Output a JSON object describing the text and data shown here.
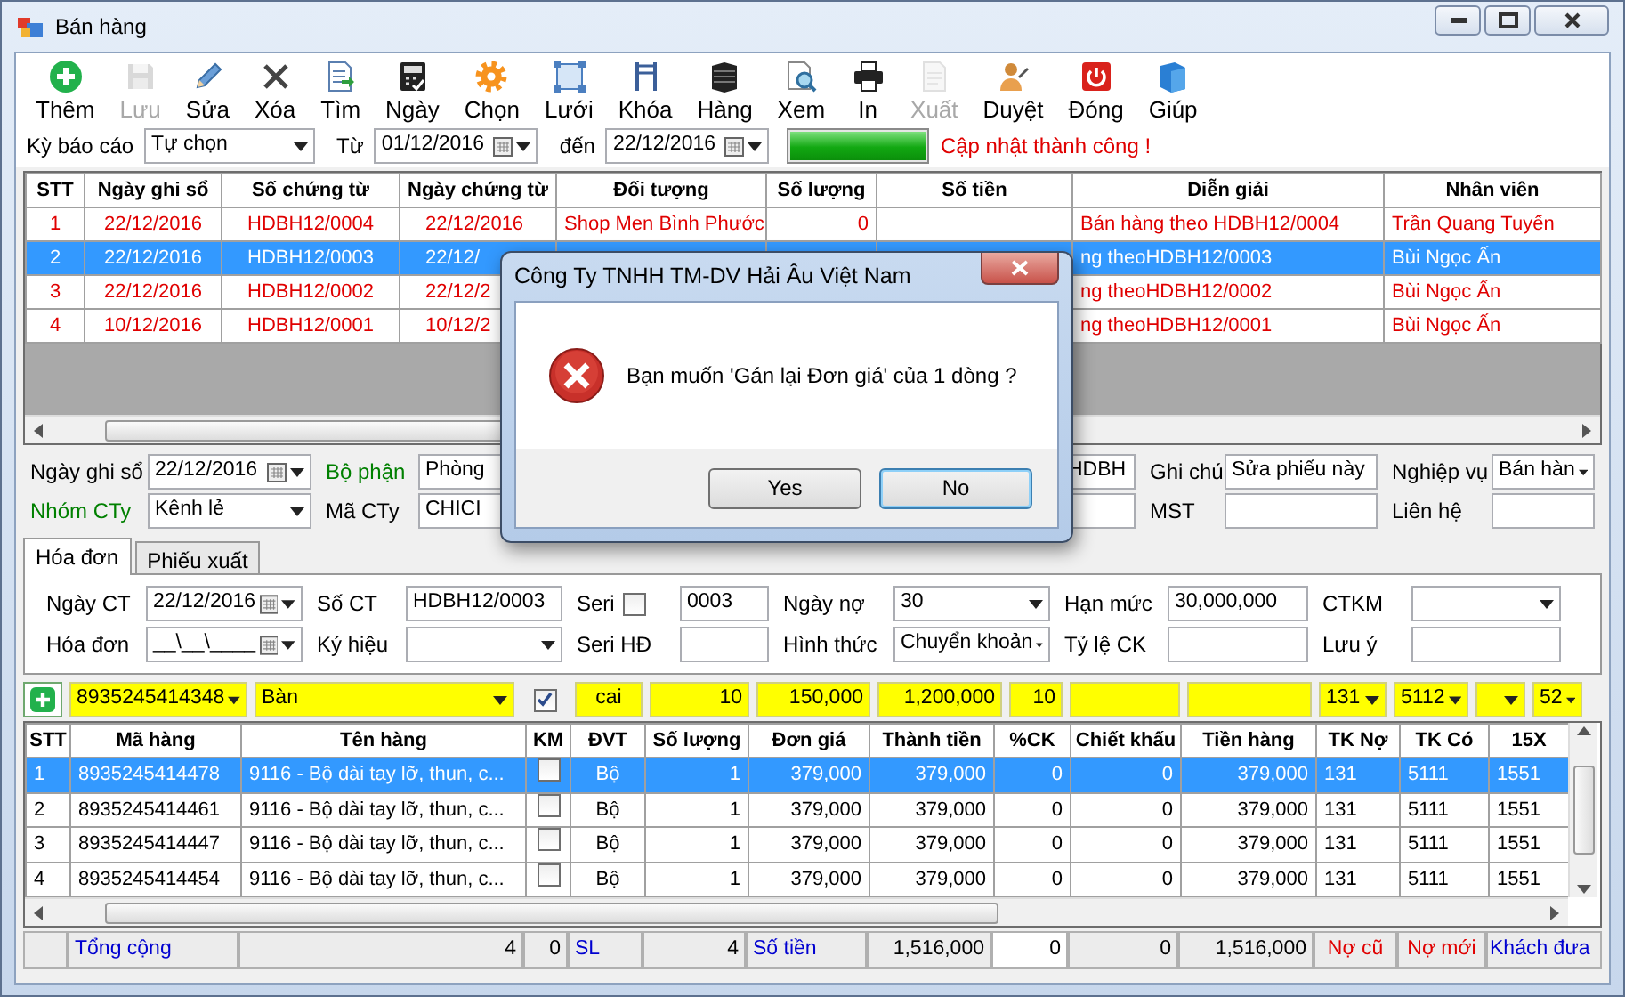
{
  "window": {
    "title": "Bán hàng"
  },
  "toolbar": [
    {
      "label": "Thêm",
      "disabled": false
    },
    {
      "label": "Lưu",
      "disabled": true
    },
    {
      "label": "Sửa",
      "disabled": false
    },
    {
      "label": "Xóa",
      "disabled": false
    },
    {
      "label": "Tìm",
      "disabled": false
    },
    {
      "label": "Ngày",
      "disabled": false
    },
    {
      "label": "Chọn",
      "disabled": false
    },
    {
      "label": "Lưới",
      "disabled": false
    },
    {
      "label": "Khóa",
      "disabled": false
    },
    {
      "label": "Hàng",
      "disabled": false
    },
    {
      "label": "Xem",
      "disabled": false
    },
    {
      "label": "In",
      "disabled": false
    },
    {
      "label": "Xuất",
      "disabled": true
    },
    {
      "label": "Duyệt",
      "disabled": false
    },
    {
      "label": "Đóng",
      "disabled": false
    },
    {
      "label": "Giúp",
      "disabled": false
    }
  ],
  "filter": {
    "period_label": "Kỳ báo cáo",
    "period": "Tự chọn",
    "from_label": "Từ",
    "from": "01/12/2016",
    "to_label": "đến",
    "to": "22/12/2016",
    "progress": {
      "level": 1
    },
    "status": "Cập nhật thành công !"
  },
  "voucher_grid": {
    "columns": [
      "STT",
      "Ngày ghi sổ",
      "Số chứng từ",
      "Ngày chứng từ",
      "Đối tượng",
      "Số lượng",
      "Số tiền",
      "Diễn giải",
      "Nhân viên"
    ],
    "rows": [
      {
        "selected": false,
        "cells": [
          "1",
          "22/12/2016",
          "HDBH12/0004",
          "22/12/2016",
          "Shop Men Bình Phước",
          "0",
          null,
          "Bán hàng theo HDBH12/0004",
          "Trần Quang Tuyến"
        ]
      },
      {
        "selected": true,
        "cells": [
          "2",
          "22/12/2016",
          "HDBH12/0003",
          "22/12/",
          null,
          null,
          null,
          "ng theoHDBH12/0003",
          "Bùi Ngọc Ấn"
        ]
      },
      {
        "selected": false,
        "cells": [
          "3",
          "22/12/2016",
          "HDBH12/0002",
          "22/12/2",
          null,
          null,
          null,
          "ng theoHDBH12/0002",
          "Bùi Ngọc Ấn"
        ]
      },
      {
        "selected": false,
        "cells": [
          "4",
          "10/12/2016",
          "HDBH12/0001",
          "10/12/2",
          null,
          null,
          null,
          "ng theoHDBH12/0001",
          "Bùi Ngọc Ấn"
        ]
      }
    ]
  },
  "header_form": {
    "rows": [
      [
        {
          "kind": "label",
          "text": "Ngày ghi sổ",
          "color": "#000000"
        },
        {
          "kind": "date",
          "value": "22/12/2016"
        },
        {
          "kind": "label",
          "text": "Bộ phận",
          "color": "#008000"
        },
        {
          "kind": "text",
          "value": "Phòng"
        },
        {
          "kind": "text",
          "value": "HDBH"
        },
        {
          "kind": "label",
          "text": "Ghi chú",
          "color": "#000000"
        },
        {
          "kind": "text",
          "value": "Sửa phiếu này"
        },
        {
          "kind": "label",
          "text": "Nghiệp vụ",
          "color": "#000000"
        },
        {
          "kind": "select",
          "value": "Bán hàn"
        }
      ],
      [
        {
          "kind": "label",
          "text": "Nhóm CTy",
          "color": "#008000"
        },
        {
          "kind": "select",
          "value": "Kênh lẻ"
        },
        {
          "kind": "label",
          "text": "Mã CTy",
          "color": "#000000"
        },
        {
          "kind": "text",
          "value": "CHICI"
        },
        {
          "kind": "text"
        },
        {
          "kind": "label",
          "text": "MST",
          "color": "#000000"
        },
        {
          "kind": "text"
        },
        {
          "kind": "label",
          "text": "Liên hệ",
          "color": "#000000"
        },
        {
          "kind": "text"
        }
      ]
    ]
  },
  "tabs": [
    {
      "label": "Hóa đơn",
      "selected": true
    },
    {
      "label": "Phiếu xuất",
      "selected": false
    }
  ],
  "invoice_form": {
    "rows": [
      [
        {
          "kind": "label",
          "text": "Ngày CT"
        },
        {
          "kind": "date",
          "value": "22/12/2016"
        },
        {
          "kind": "label",
          "text": "Số CT"
        },
        {
          "kind": "text",
          "value": "HDBH12/0003"
        },
        {
          "kind": "label",
          "text": "Seri",
          "checkbox": {
            "checked": false
          }
        },
        {
          "kind": "text",
          "value": "0003"
        },
        {
          "kind": "label",
          "text": "Ngày nợ"
        },
        {
          "kind": "select",
          "value": "30"
        },
        {
          "kind": "label",
          "text": "Hạn mức"
        },
        {
          "kind": "text",
          "value": "30,000,000"
        },
        {
          "kind": "label",
          "text": "CTKM"
        },
        {
          "kind": "select"
        }
      ],
      [
        {
          "kind": "label",
          "text": "Hóa đơn"
        },
        {
          "kind": "date",
          "value": "__\\__\\____"
        },
        {
          "kind": "label",
          "text": "Ký hiệu"
        },
        {
          "kind": "select"
        },
        {
          "kind": "label",
          "text": "Seri HĐ"
        },
        {
          "kind": "text"
        },
        {
          "kind": "label",
          "text": "Hình thức"
        },
        {
          "kind": "select",
          "value": "Chuyển khoản"
        },
        {
          "kind": "label",
          "text": "Tỷ lệ CK"
        },
        {
          "kind": "text"
        },
        {
          "kind": "label",
          "text": "Lưu ý"
        },
        {
          "kind": "text"
        }
      ]
    ]
  },
  "entry_row": [
    {
      "kind": "add"
    },
    {
      "kind": "combo",
      "value": "8935245414348"
    },
    {
      "kind": "combo",
      "value": "Bàn"
    },
    {
      "kind": "check",
      "checked": true
    },
    {
      "kind": "text",
      "value": "cai"
    },
    {
      "kind": "number",
      "value": "10"
    },
    {
      "kind": "number",
      "value": "150,000"
    },
    {
      "kind": "number",
      "value": "1,200,000"
    },
    {
      "kind": "number",
      "value": "10"
    },
    {
      "kind": "text"
    },
    {
      "kind": "text"
    },
    {
      "kind": "combo",
      "value": "131"
    },
    {
      "kind": "combo",
      "value": "5112"
    },
    {
      "kind": "combo"
    },
    {
      "kind": "combo",
      "value": "52"
    }
  ],
  "items_grid": {
    "columns": [
      "STT",
      "Mã hàng",
      "Tên hàng",
      "KM",
      "ĐVT",
      "Số lượng",
      "Đơn giá",
      "Thành tiền",
      "%CK",
      "Chiết khấu",
      "Tiền hàng",
      "TK Nợ",
      "TK Có",
      "15X"
    ],
    "rows": [
      {
        "selected": true,
        "km": false,
        "cells": [
          "1",
          "8935245414478",
          "9116 - Bộ dài tay lỡ, thun, c...",
          null,
          "Bộ",
          "1",
          "379,000",
          "379,000",
          "0",
          "0",
          "379,000",
          "131",
          "5111",
          "1551"
        ]
      },
      {
        "selected": false,
        "km": false,
        "cells": [
          "2",
          "8935245414461",
          "9116 - Bộ dài tay lỡ, thun, c...",
          null,
          "Bộ",
          "1",
          "379,000",
          "379,000",
          "0",
          "0",
          "379,000",
          "131",
          "5111",
          "1551"
        ]
      },
      {
        "selected": false,
        "km": false,
        "cells": [
          "3",
          "8935245414447",
          "9116 - Bộ dài tay lỡ, thun, c...",
          null,
          "Bộ",
          "1",
          "379,000",
          "379,000",
          "0",
          "0",
          "379,000",
          "131",
          "5111",
          "1551"
        ]
      },
      {
        "selected": false,
        "km": false,
        "cells": [
          "4",
          "8935245414454",
          "9116 - Bộ dài tay lỡ, thun, c...",
          null,
          "Bộ",
          "1",
          "379,000",
          "379,000",
          "0",
          "0",
          "379,000",
          "131",
          "5111",
          "1551"
        ]
      }
    ]
  },
  "totals": [
    {
      "kind": "blank"
    },
    {
      "kind": "caption",
      "text": "Tổng cộng"
    },
    {
      "kind": "number",
      "text": "4"
    },
    {
      "kind": "number",
      "text": "0"
    },
    {
      "kind": "caption",
      "text": "SL"
    },
    {
      "kind": "number",
      "text": "4"
    },
    {
      "kind": "caption",
      "text": "Số tiền"
    },
    {
      "kind": "number",
      "text": "1,516,000"
    },
    {
      "kind": "input",
      "text": "0"
    },
    {
      "kind": "number",
      "text": "0"
    },
    {
      "kind": "number",
      "text": "1,516,000"
    },
    {
      "kind": "alert",
      "text": "Nợ cũ"
    },
    {
      "kind": "alert",
      "text": "Nợ mới"
    },
    {
      "kind": "caption",
      "text": "Khách đưa"
    }
  ],
  "dialog": {
    "title": "Công Ty TNHH TM-DV Hải Âu Việt Nam",
    "message": "Bạn muốn 'Gán lại Đơn giá' của 1 dòng ?",
    "buttons": [
      {
        "label": "Yes",
        "default": false
      },
      {
        "label": "No",
        "default": true
      }
    ]
  }
}
